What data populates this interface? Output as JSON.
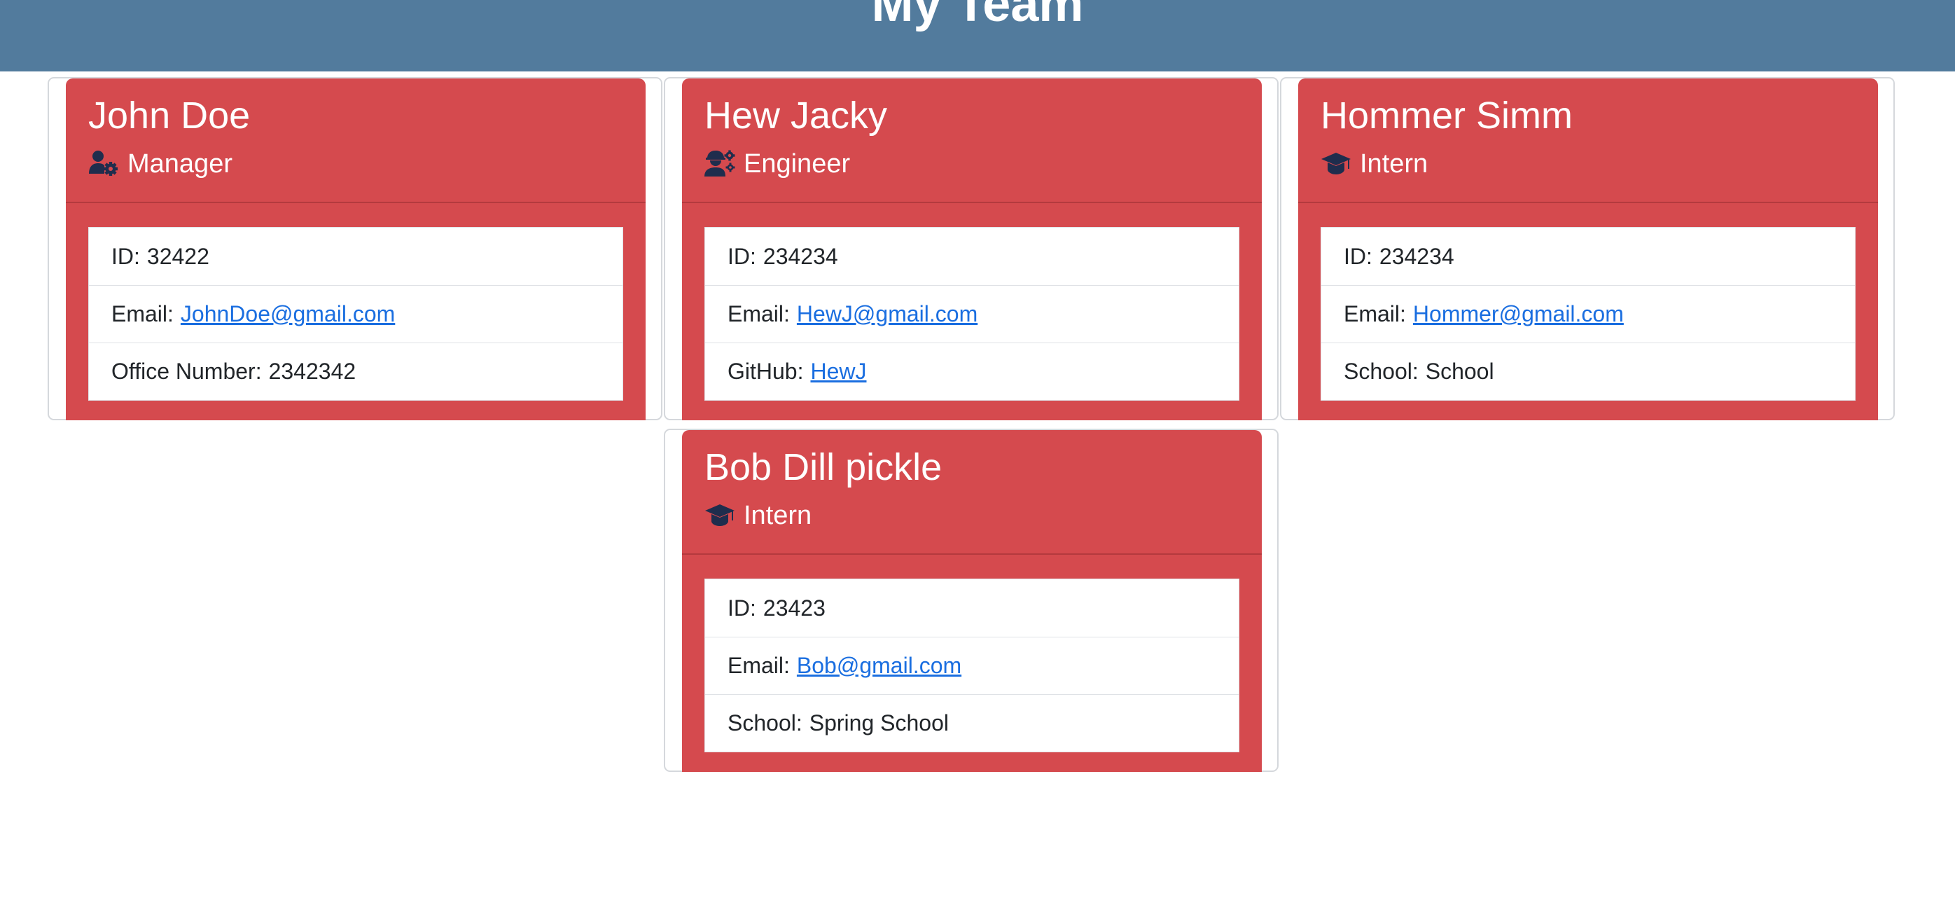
{
  "header": {
    "title": "My Team"
  },
  "colors": {
    "header_bg": "#527b9d",
    "card_bg": "#d54a4e",
    "link": "#1a6ee0",
    "icon": "#1f2d4d"
  },
  "employees": [
    {
      "name": "John Doe",
      "role": "Manager",
      "role_icon": "user-gear-icon",
      "id_label": "ID:",
      "id": "32422",
      "email_label": "Email:",
      "email": "JohnDoe@gmail.com",
      "extra_label": "Office Number:",
      "extra_value": "2342342"
    },
    {
      "name": "Hew Jacky",
      "role": "Engineer",
      "role_icon": "user-gears-icon",
      "id_label": "ID:",
      "id": "234234",
      "email_label": "Email:",
      "email": "HewJ@gmail.com",
      "extra_label": "GitHub:",
      "extra_value": "HewJ"
    },
    {
      "name": "Hommer Simm",
      "role": "Intern",
      "role_icon": "graduation-cap-icon",
      "id_label": "ID:",
      "id": "234234",
      "email_label": "Email:",
      "email": "Hommer@gmail.com",
      "extra_label": "School:",
      "extra_value": "School"
    },
    {
      "name": "Bob Dill pickle",
      "role": "Intern",
      "role_icon": "graduation-cap-icon",
      "id_label": "ID:",
      "id": "23423",
      "email_label": "Email:",
      "email": "Bob@gmail.com",
      "extra_label": "School:",
      "extra_value": "Spring School"
    }
  ]
}
